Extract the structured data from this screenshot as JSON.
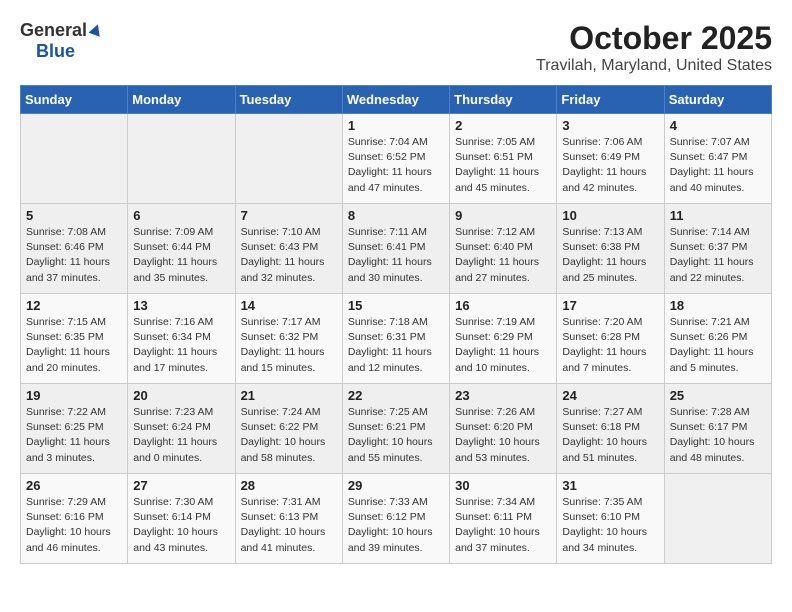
{
  "header": {
    "logo_general": "General",
    "logo_blue": "Blue",
    "month": "October 2025",
    "location": "Travilah, Maryland, United States"
  },
  "weekdays": [
    "Sunday",
    "Monday",
    "Tuesday",
    "Wednesday",
    "Thursday",
    "Friday",
    "Saturday"
  ],
  "weeks": [
    [
      {
        "day": "",
        "sunrise": "",
        "sunset": "",
        "daylight": ""
      },
      {
        "day": "",
        "sunrise": "",
        "sunset": "",
        "daylight": ""
      },
      {
        "day": "",
        "sunrise": "",
        "sunset": "",
        "daylight": ""
      },
      {
        "day": "1",
        "sunrise": "Sunrise: 7:04 AM",
        "sunset": "Sunset: 6:52 PM",
        "daylight": "Daylight: 11 hours and 47 minutes."
      },
      {
        "day": "2",
        "sunrise": "Sunrise: 7:05 AM",
        "sunset": "Sunset: 6:51 PM",
        "daylight": "Daylight: 11 hours and 45 minutes."
      },
      {
        "day": "3",
        "sunrise": "Sunrise: 7:06 AM",
        "sunset": "Sunset: 6:49 PM",
        "daylight": "Daylight: 11 hours and 42 minutes."
      },
      {
        "day": "4",
        "sunrise": "Sunrise: 7:07 AM",
        "sunset": "Sunset: 6:47 PM",
        "daylight": "Daylight: 11 hours and 40 minutes."
      }
    ],
    [
      {
        "day": "5",
        "sunrise": "Sunrise: 7:08 AM",
        "sunset": "Sunset: 6:46 PM",
        "daylight": "Daylight: 11 hours and 37 minutes."
      },
      {
        "day": "6",
        "sunrise": "Sunrise: 7:09 AM",
        "sunset": "Sunset: 6:44 PM",
        "daylight": "Daylight: 11 hours and 35 minutes."
      },
      {
        "day": "7",
        "sunrise": "Sunrise: 7:10 AM",
        "sunset": "Sunset: 6:43 PM",
        "daylight": "Daylight: 11 hours and 32 minutes."
      },
      {
        "day": "8",
        "sunrise": "Sunrise: 7:11 AM",
        "sunset": "Sunset: 6:41 PM",
        "daylight": "Daylight: 11 hours and 30 minutes."
      },
      {
        "day": "9",
        "sunrise": "Sunrise: 7:12 AM",
        "sunset": "Sunset: 6:40 PM",
        "daylight": "Daylight: 11 hours and 27 minutes."
      },
      {
        "day": "10",
        "sunrise": "Sunrise: 7:13 AM",
        "sunset": "Sunset: 6:38 PM",
        "daylight": "Daylight: 11 hours and 25 minutes."
      },
      {
        "day": "11",
        "sunrise": "Sunrise: 7:14 AM",
        "sunset": "Sunset: 6:37 PM",
        "daylight": "Daylight: 11 hours and 22 minutes."
      }
    ],
    [
      {
        "day": "12",
        "sunrise": "Sunrise: 7:15 AM",
        "sunset": "Sunset: 6:35 PM",
        "daylight": "Daylight: 11 hours and 20 minutes."
      },
      {
        "day": "13",
        "sunrise": "Sunrise: 7:16 AM",
        "sunset": "Sunset: 6:34 PM",
        "daylight": "Daylight: 11 hours and 17 minutes."
      },
      {
        "day": "14",
        "sunrise": "Sunrise: 7:17 AM",
        "sunset": "Sunset: 6:32 PM",
        "daylight": "Daylight: 11 hours and 15 minutes."
      },
      {
        "day": "15",
        "sunrise": "Sunrise: 7:18 AM",
        "sunset": "Sunset: 6:31 PM",
        "daylight": "Daylight: 11 hours and 12 minutes."
      },
      {
        "day": "16",
        "sunrise": "Sunrise: 7:19 AM",
        "sunset": "Sunset: 6:29 PM",
        "daylight": "Daylight: 11 hours and 10 minutes."
      },
      {
        "day": "17",
        "sunrise": "Sunrise: 7:20 AM",
        "sunset": "Sunset: 6:28 PM",
        "daylight": "Daylight: 11 hours and 7 minutes."
      },
      {
        "day": "18",
        "sunrise": "Sunrise: 7:21 AM",
        "sunset": "Sunset: 6:26 PM",
        "daylight": "Daylight: 11 hours and 5 minutes."
      }
    ],
    [
      {
        "day": "19",
        "sunrise": "Sunrise: 7:22 AM",
        "sunset": "Sunset: 6:25 PM",
        "daylight": "Daylight: 11 hours and 3 minutes."
      },
      {
        "day": "20",
        "sunrise": "Sunrise: 7:23 AM",
        "sunset": "Sunset: 6:24 PM",
        "daylight": "Daylight: 11 hours and 0 minutes."
      },
      {
        "day": "21",
        "sunrise": "Sunrise: 7:24 AM",
        "sunset": "Sunset: 6:22 PM",
        "daylight": "Daylight: 10 hours and 58 minutes."
      },
      {
        "day": "22",
        "sunrise": "Sunrise: 7:25 AM",
        "sunset": "Sunset: 6:21 PM",
        "daylight": "Daylight: 10 hours and 55 minutes."
      },
      {
        "day": "23",
        "sunrise": "Sunrise: 7:26 AM",
        "sunset": "Sunset: 6:20 PM",
        "daylight": "Daylight: 10 hours and 53 minutes."
      },
      {
        "day": "24",
        "sunrise": "Sunrise: 7:27 AM",
        "sunset": "Sunset: 6:18 PM",
        "daylight": "Daylight: 10 hours and 51 minutes."
      },
      {
        "day": "25",
        "sunrise": "Sunrise: 7:28 AM",
        "sunset": "Sunset: 6:17 PM",
        "daylight": "Daylight: 10 hours and 48 minutes."
      }
    ],
    [
      {
        "day": "26",
        "sunrise": "Sunrise: 7:29 AM",
        "sunset": "Sunset: 6:16 PM",
        "daylight": "Daylight: 10 hours and 46 minutes."
      },
      {
        "day": "27",
        "sunrise": "Sunrise: 7:30 AM",
        "sunset": "Sunset: 6:14 PM",
        "daylight": "Daylight: 10 hours and 43 minutes."
      },
      {
        "day": "28",
        "sunrise": "Sunrise: 7:31 AM",
        "sunset": "Sunset: 6:13 PM",
        "daylight": "Daylight: 10 hours and 41 minutes."
      },
      {
        "day": "29",
        "sunrise": "Sunrise: 7:33 AM",
        "sunset": "Sunset: 6:12 PM",
        "daylight": "Daylight: 10 hours and 39 minutes."
      },
      {
        "day": "30",
        "sunrise": "Sunrise: 7:34 AM",
        "sunset": "Sunset: 6:11 PM",
        "daylight": "Daylight: 10 hours and 37 minutes."
      },
      {
        "day": "31",
        "sunrise": "Sunrise: 7:35 AM",
        "sunset": "Sunset: 6:10 PM",
        "daylight": "Daylight: 10 hours and 34 minutes."
      },
      {
        "day": "",
        "sunrise": "",
        "sunset": "",
        "daylight": ""
      }
    ]
  ]
}
